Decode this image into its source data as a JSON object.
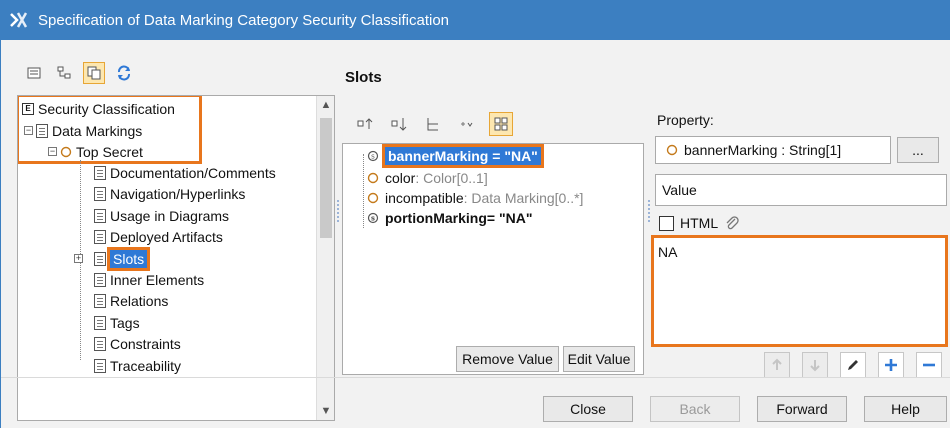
{
  "window": {
    "title": "Specification of Data Marking Category Security Classification"
  },
  "tree": {
    "items": [
      {
        "label": "Security Classification",
        "icon": "enum-icon",
        "expander": ""
      },
      {
        "label": "Data Markings",
        "icon": "doc-icon",
        "expander": "−"
      },
      {
        "label": "Top Secret",
        "icon": "diamond-icon",
        "expander": "−"
      },
      {
        "label": "Documentation/Comments",
        "icon": "doc-icon"
      },
      {
        "label": "Navigation/Hyperlinks",
        "icon": "doc-icon"
      },
      {
        "label": "Usage in Diagrams",
        "icon": "doc-icon"
      },
      {
        "label": "Deployed Artifacts",
        "icon": "doc-icon"
      },
      {
        "label": "Slots",
        "icon": "doc-icon",
        "expander": "+"
      },
      {
        "label": "Inner Elements",
        "icon": "doc-icon"
      },
      {
        "label": "Relations",
        "icon": "doc-icon"
      },
      {
        "label": "Tags",
        "icon": "doc-icon"
      },
      {
        "label": "Constraints",
        "icon": "doc-icon"
      },
      {
        "label": "Traceability",
        "icon": "doc-icon"
      }
    ]
  },
  "slots": {
    "title": "Slots",
    "rows": [
      {
        "name": "bannerMarking",
        "suffix": " = \"NA\"",
        "bold": true,
        "selected": true
      },
      {
        "name": "color",
        "suffix": " : Color[0..1]",
        "bold": false
      },
      {
        "name": "incompatible",
        "suffix": " : Data Marking[0..*]",
        "bold": false
      },
      {
        "name": "portionMarking",
        "suffix": " = \"NA\"",
        "bold": true
      }
    ],
    "remove_value": "Remove Value",
    "edit_value": "Edit Value"
  },
  "property": {
    "label": "Property:",
    "value": "bannerMarking : String[1]",
    "ellipsis": "...",
    "value_header": "Value",
    "html_label": "HTML",
    "text_value": "NA"
  },
  "footer": {
    "close": "Close",
    "back": "Back",
    "forward": "Forward",
    "help": "Help"
  },
  "colors": {
    "titlebar": "#3c7fc1",
    "highlight": "#e8761d",
    "selection": "#2f79d6",
    "add_icon": "#2f79d6"
  }
}
